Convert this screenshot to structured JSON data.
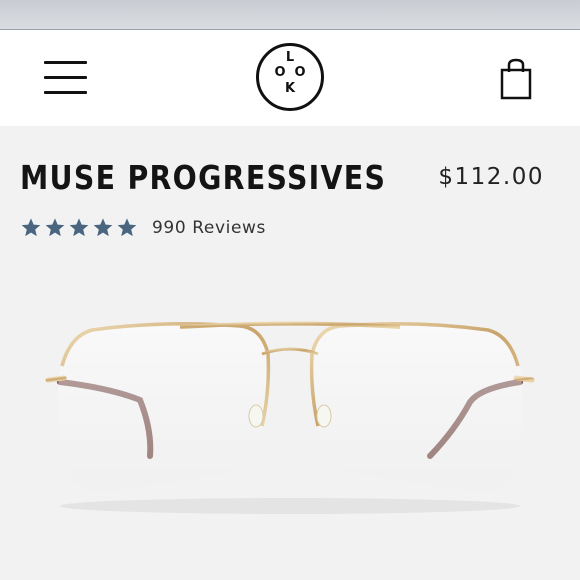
{
  "header": {
    "menu_icon": "hamburger-menu-icon",
    "logo": {
      "letters": [
        "L",
        "O",
        "O",
        "K"
      ]
    },
    "cart_icon": "shopping-bag-icon"
  },
  "product": {
    "title": "MUSE PROGRESSIVES",
    "price": "$112.00",
    "rating": {
      "stars": 5,
      "max": 5,
      "star_color": "#4a6580"
    },
    "reviews_label": "990 Reviews",
    "image": "gold-aviator-eyeglasses-image"
  }
}
